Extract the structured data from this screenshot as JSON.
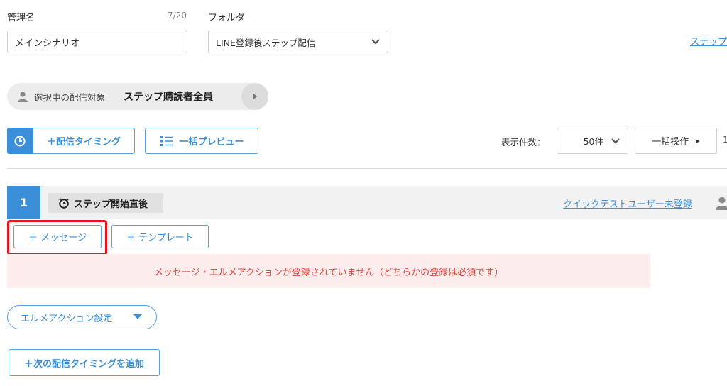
{
  "form": {
    "name_label": "管理名",
    "name_counter": "7/20",
    "name_value": "メインシナリオ",
    "folder_label": "フォルダ",
    "folder_value": "LINE登録後ステップ配信",
    "top_right_link": "ステップ"
  },
  "target": {
    "label": "選択中の配信対象",
    "value": "ステップ購読者全員"
  },
  "toolbar": {
    "add_timing": "＋配信タイミング",
    "bulk_preview": "一括プレビュー",
    "display_count_label": "表示件数：",
    "display_count_value": "50件",
    "bulk_action": "一括操作",
    "bulk_action_arrow": "▸",
    "right_edge_glyph": "1"
  },
  "step": {
    "number": "1",
    "timing": "ステップ開始直後",
    "quick_test_link": "クイックテストユーザー未登録",
    "add_message": "＋ メッセージ",
    "add_template": "＋ テンプレート",
    "alert": "メッセージ・エルメアクションが登録されていません（どちらかの登録は必須です）",
    "elme_action": "エルメアクション設定",
    "add_next_timing": "＋次の配信タイミングを追加"
  },
  "colors": {
    "accent": "#3a8fd8",
    "alert_bg": "#fdecec",
    "alert_text": "#e0443e",
    "highlight": "#e6141e"
  }
}
